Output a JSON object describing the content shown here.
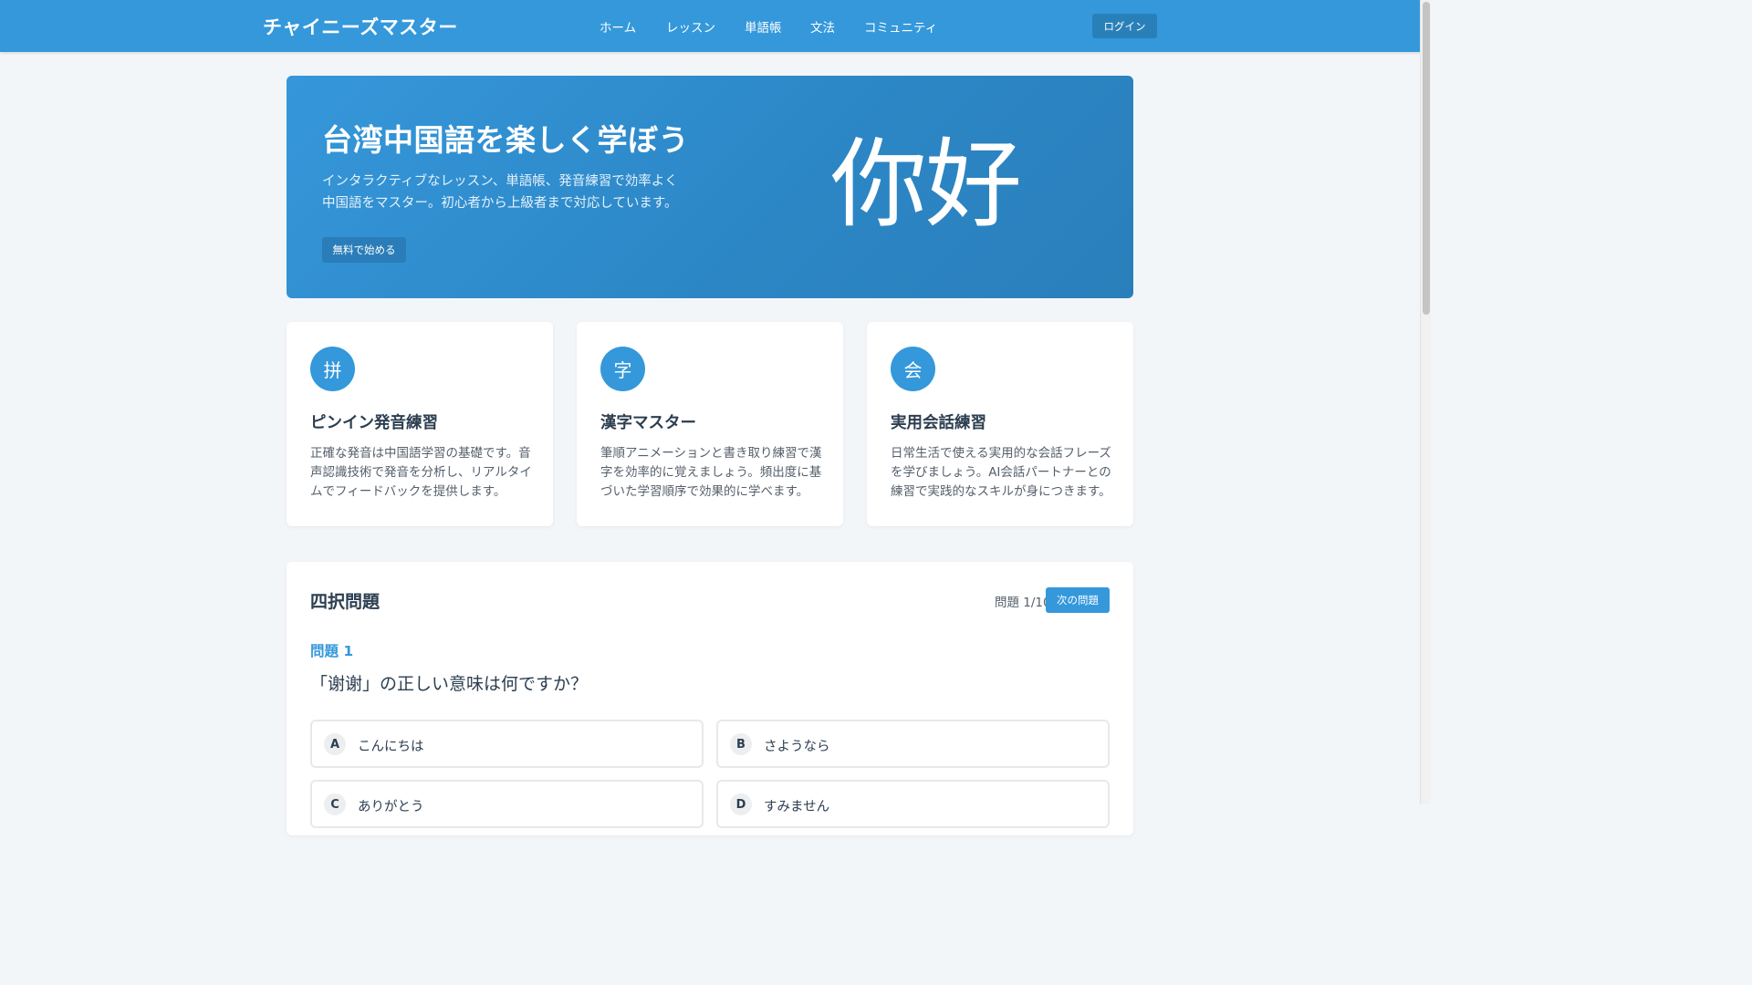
{
  "header": {
    "brand": "チャイニーズマスター",
    "nav": [
      "ホーム",
      "レッスン",
      "単語帳",
      "文法",
      "コミュニティ"
    ],
    "login_label": "ログイン"
  },
  "hero": {
    "title": "台湾中国語を楽しく学ぼう",
    "description_lines": [
      "インタラクティブなレッスン、単語帳、発音練習で効率よく",
      "中国語をマスター。初心者から上級者まで対応しています。"
    ],
    "cta_label": "無料で始める",
    "character": "你好"
  },
  "features": [
    {
      "icon_char": "拼",
      "title": "ピンイン発音練習",
      "description_lines": [
        "正確な発音は中国語学習の基礎です。音",
        "声認識技術で発音を分析し、リアルタイ",
        "ムでフィードバックを提供します。"
      ]
    },
    {
      "icon_char": "字",
      "title": "漢字マスター",
      "description_lines": [
        "筆順アニメーションと書き取り練習で漢",
        "字を効率的に覚えましょう。頻出度に基",
        "づいた学習順序で効果的に学べます。"
      ]
    },
    {
      "icon_char": "会",
      "title": "実用会話練習",
      "description_lines": [
        "日常生活で使える実用的な会話フレーズ",
        "を学びましょう。AI会話パートナーとの",
        "練習で実践的なスキルが身につきます。"
      ]
    }
  ],
  "quiz": {
    "title": "四択問題",
    "counter": "問題 1/10",
    "next_label": "次の問題",
    "question_number": "問題 1",
    "question_text": "「谢谢」の正しい意味は何ですか？",
    "options": [
      {
        "letter": "A",
        "text": "こんにちは"
      },
      {
        "letter": "B",
        "text": "さようなら"
      },
      {
        "letter": "C",
        "text": "ありがとう"
      },
      {
        "letter": "D",
        "text": "すみません"
      }
    ]
  }
}
